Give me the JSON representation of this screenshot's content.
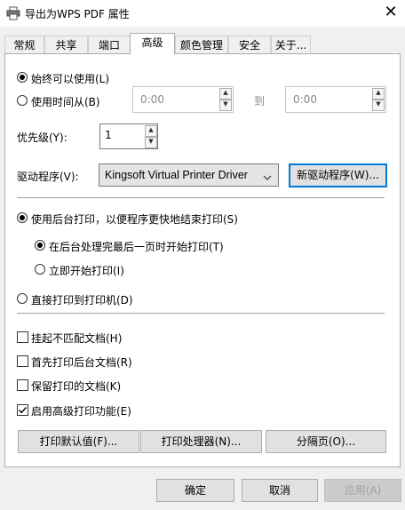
{
  "window": {
    "title": "导出为WPS PDF 属性",
    "close_glyph": "✕"
  },
  "tabs": [
    {
      "label": "常规"
    },
    {
      "label": "共享"
    },
    {
      "label": "端口"
    },
    {
      "label": "高级"
    },
    {
      "label": "颜色管理"
    },
    {
      "label": "安全"
    },
    {
      "label": "关于..."
    }
  ],
  "active_tab": "高级",
  "availability": {
    "always_label": "始终可以使用(L)",
    "always_selected": true,
    "from_label": "使用时间从(B)",
    "from_selected": false,
    "from_time": "0:00",
    "to_label": "到",
    "to_time": "0:00"
  },
  "priority": {
    "label": "优先级(Y):",
    "value": "1"
  },
  "driver": {
    "label": "驱动程序(V):",
    "selected": "Kingsoft Virtual Printer Driver",
    "new_driver_button": "新驱动程序(W)..."
  },
  "spool": {
    "spool_label": "使用后台打印，以便程序更快地结束打印(S)",
    "spool_selected": true,
    "after_last_page_label": "在后台处理完最后一页时开始打印(T)",
    "after_last_page_selected": true,
    "immediately_label": "立即开始打印(I)",
    "immediately_selected": false,
    "direct_label": "直接打印到打印机(D)",
    "direct_selected": false
  },
  "options": [
    {
      "label": "挂起不匹配文档(H)",
      "checked": false
    },
    {
      "label": "首先打印后台文档(R)",
      "checked": false
    },
    {
      "label": "保留打印的文档(K)",
      "checked": false
    },
    {
      "label": "启用高级打印功能(E)",
      "checked": true
    }
  ],
  "bottom_buttons": {
    "defaults": "打印默认值(F)...",
    "processor": "打印处理器(N)...",
    "separator_page": "分隔页(O)..."
  },
  "dialog_buttons": {
    "ok": "确定",
    "cancel": "取消",
    "apply": "应用(A)"
  },
  "colors": {
    "focus_accent": "#0078d7"
  },
  "icons": {
    "window_icon": "printer-icon",
    "spin_up": "▲",
    "spin_down": "▼",
    "dropdown": "chevron-down-icon"
  }
}
